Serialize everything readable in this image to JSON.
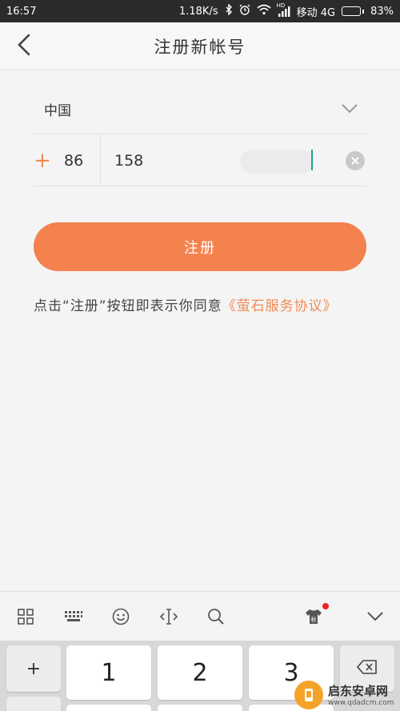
{
  "status_bar": {
    "time": "16:57",
    "speed": "1.18K/s",
    "carrier": "移动 4G",
    "battery_percent": "83%",
    "battery_level": 0.83,
    "signal_label": "HD"
  },
  "header": {
    "title": "注册新帐号"
  },
  "form": {
    "country": "中国",
    "plus": "+",
    "country_code": "86",
    "phone_value": "158"
  },
  "register_button": {
    "label": "注册"
  },
  "agreement": {
    "prefix": "点击“注册”按钮即表示你同意",
    "link": "《萤石服务协议》"
  },
  "keyboard": {
    "side_key": "+",
    "keys": [
      "1",
      "2",
      "3"
    ]
  },
  "colors": {
    "accent": "#f4824e",
    "caret": "#1aa48d",
    "notification_dot": "#ee2222"
  },
  "watermark": {
    "name": "启东安卓网",
    "url": "www.qdadcm.com"
  }
}
